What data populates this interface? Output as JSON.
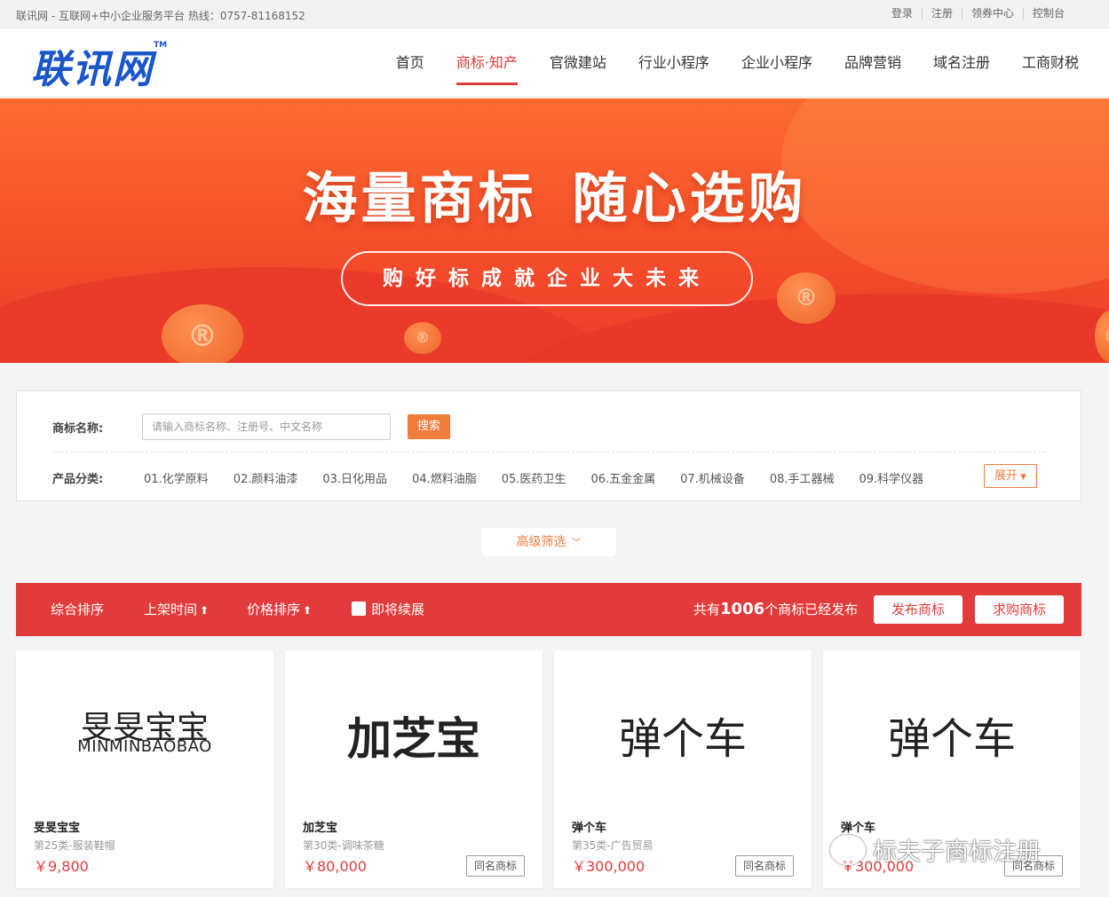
{
  "topbar": {
    "site_info": "联讯网 - 互联网+中小企业服务平台 热线：0757-81168152",
    "links": [
      "登录",
      "注册",
      "领券中心",
      "控制台"
    ]
  },
  "header": {
    "logo_text": "联讯网",
    "logo_tm": "TM",
    "nav": [
      "首页",
      "商标·知产",
      "官微建站",
      "行业小程序",
      "企业小程序",
      "品牌营销",
      "域名注册",
      "工商财税"
    ],
    "active_nav": "商标·知产"
  },
  "banner": {
    "title_part1": "海量商标",
    "title_part2": "随心选购",
    "slogan": "购好标成就企业大未来"
  },
  "search": {
    "name_label": "商标名称:",
    "placeholder": "请输入商标名称、注册号、中文名称",
    "search_button": "搜索",
    "category_label": "产品分类:",
    "categories": [
      "01.化学原料",
      "02.颜料油漆",
      "03.日化用品",
      "04.燃料油脂",
      "05.医药卫生",
      "06.五金金属",
      "07.机械设备",
      "08.手工器械",
      "09.科学仪器"
    ],
    "expand_label": "展开"
  },
  "advanced_filter": "高级筛选",
  "sortbar": {
    "overall": "综合排序",
    "listing_time": "上架时间",
    "price_sort": "价格排序",
    "renew_soon": "即将续展",
    "count_prefix": "共有",
    "count_value": "1006",
    "count_suffix": "个商标已经发布",
    "publish_button": "发布商标",
    "buy_button": "求购商标"
  },
  "cards": [
    {
      "mark_cn": "旻旻宝宝",
      "mark_en": "MINMINBAOBAO",
      "name": "旻旻宝宝",
      "class": "第25类-服装鞋帽",
      "price": "￥9,800",
      "same_button": ""
    },
    {
      "mark_cn": "加芝宝",
      "mark_en": "",
      "name": "加芝宝",
      "class": "第30类-调味茶糖",
      "price": "￥80,000",
      "same_button": "同名商标"
    },
    {
      "mark_cn": "弹个车",
      "mark_en": "",
      "name": "弹个车",
      "class": "第35类-广告贸易",
      "price": "￥300,000",
      "same_button": "同名商标"
    },
    {
      "mark_cn": "弹个车",
      "mark_en": "",
      "name": "弹个车",
      "class": "",
      "price": "￥300,000",
      "same_button": "同名商标"
    }
  ],
  "watermark": "标夫子商标注册",
  "colors": {
    "brand_red": "#e23b3b",
    "accent_orange": "#f07c3c",
    "logo_blue": "#1a55c9"
  }
}
